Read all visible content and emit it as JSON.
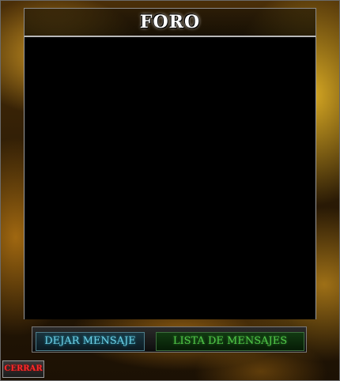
{
  "window": {
    "title": "FORO"
  },
  "tabs": {
    "leave_message": "DEJAR MENSAJE",
    "message_list": "LISTA DE MENSAJES"
  },
  "close_label": "CERRAR"
}
